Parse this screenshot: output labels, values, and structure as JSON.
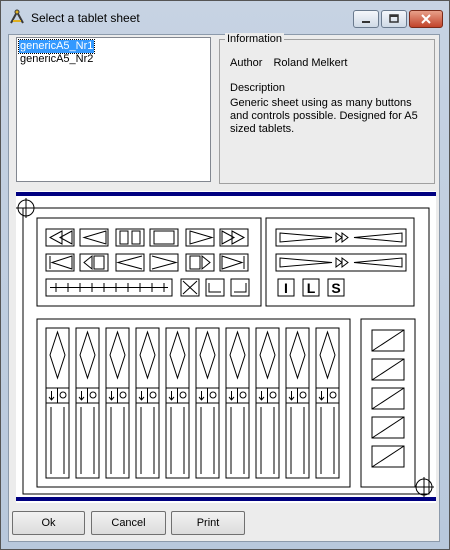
{
  "window": {
    "title": "Select a tablet sheet"
  },
  "sheet_list": {
    "items": [
      "genericA5_Nr1",
      "genericA5_Nr2"
    ],
    "selected_index": 0
  },
  "information": {
    "caption": "Information",
    "author_label": "Author",
    "author_value": "Roland Melkert",
    "description_label": "Description",
    "description_text": "Generic sheet using as many buttons and controls possible. Designed for A5 sized tablets."
  },
  "buttons": {
    "ok": "Ok",
    "cancel": "Cancel",
    "print": "Print"
  },
  "preview": {
    "top_left_icons": [
      "jump-to-start-icon",
      "step-back-icon",
      "pause-icon",
      "stop-icon",
      "play-icon",
      "fast-forward-icon"
    ],
    "mid_left_icons": [
      "skip-to-start-icon",
      "previous-frame-icon",
      "rewind-icon",
      "forward-icon",
      "next-frame-icon",
      "skip-to-end-icon"
    ],
    "letter_buttons": [
      "I",
      "L",
      "S"
    ],
    "slider_count": 10,
    "side_button_count": 5
  },
  "colors": {
    "selection": "#3399ff",
    "sheet_border": "#000080"
  }
}
